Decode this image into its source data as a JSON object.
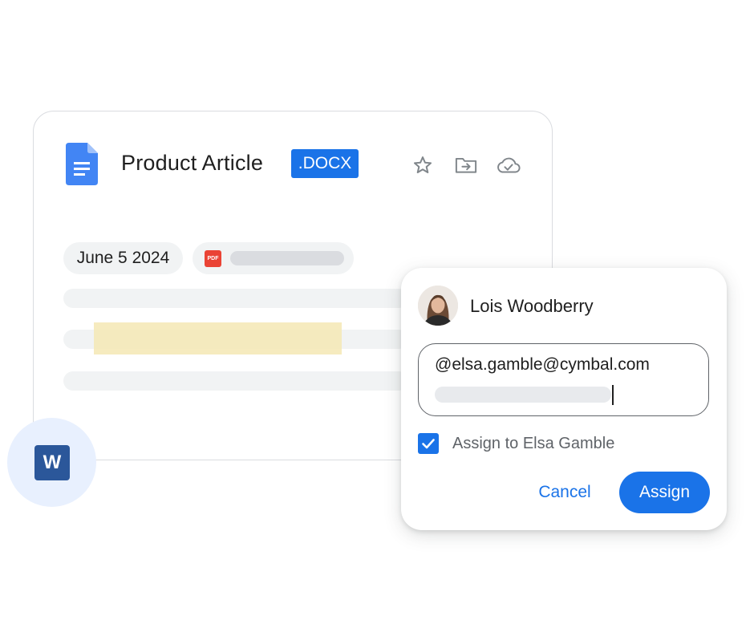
{
  "document": {
    "title": "Product Article",
    "format_badge": ".DOCX",
    "date_chip": "June 5 2024",
    "pdf_icon_label": "PDF",
    "icons": [
      "docs-icon",
      "star-icon",
      "move-to-folder-icon",
      "cloud-done-icon",
      "pdf-icon",
      "word-icon"
    ]
  },
  "word_badge": {
    "letter": "W"
  },
  "assign_popup": {
    "user_name": "Lois Woodberry",
    "mention": "@elsa.gamble@cymbal.com",
    "checkbox_checked": true,
    "checkbox_label": "Assign to Elsa Gamble",
    "cancel_label": "Cancel",
    "assign_label": "Assign"
  },
  "colors": {
    "accent": "#1a73e8",
    "word_blue": "#2b579a",
    "pdf_red": "#ea4335",
    "highlight": "#f5e7b4",
    "placeholder_gray": "#f1f3f4"
  }
}
